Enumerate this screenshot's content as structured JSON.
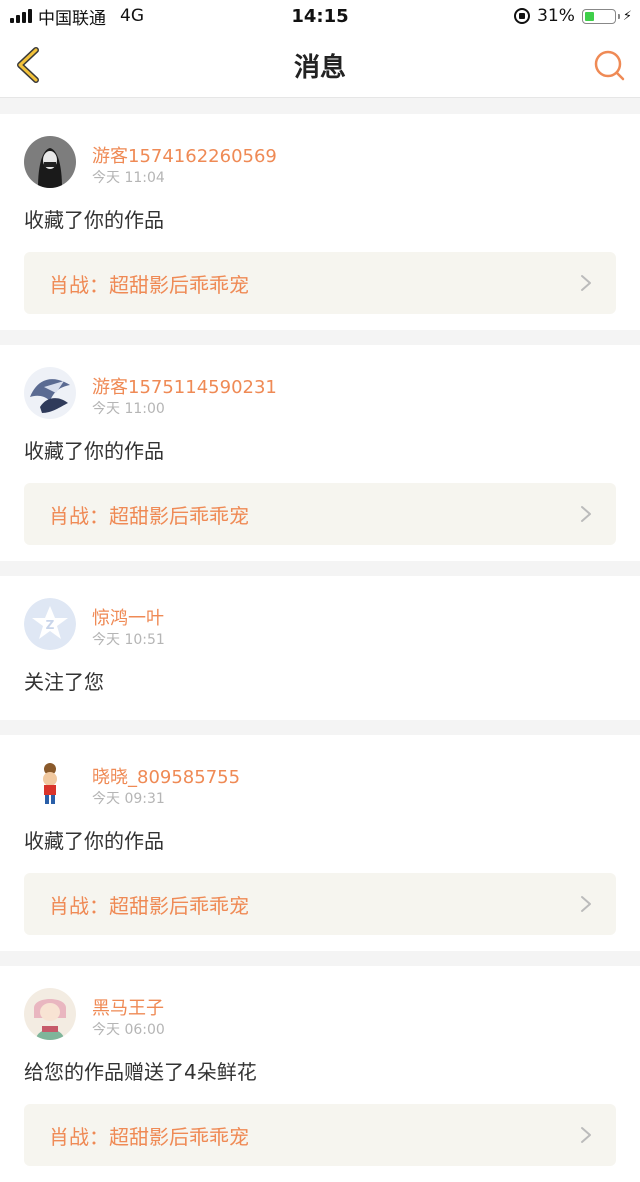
{
  "status_bar": {
    "carrier": "中国联通",
    "network": "4G",
    "time": "14:15",
    "battery_percent": "31%",
    "battery_level": 0.31
  },
  "nav": {
    "title": "消息",
    "back_icon": "chevron-left-icon",
    "search_icon": "search-icon",
    "accent_color": "#ef8a55"
  },
  "colors": {
    "username": "#ef8a55",
    "timestamp": "#b5b5b5",
    "work_bg": "#f6f5ef",
    "page_bg": "#f4f4f4"
  },
  "messages": [
    {
      "username": "游客1574162260569",
      "time": "今天 11:04",
      "action": "收藏了你的作品",
      "work": "肖战：超甜影后乖乖宠"
    },
    {
      "username": "游客1575114590231",
      "time": "今天 11:00",
      "action": "收藏了你的作品",
      "work": "肖战：超甜影后乖乖宠"
    },
    {
      "username": "惊鸿一叶",
      "time": "今天 10:51",
      "action": "关注了您"
    },
    {
      "username": "晓晓_809585755",
      "time": "今天 09:31",
      "action": "收藏了你的作品",
      "work": "肖战：超甜影后乖乖宠"
    },
    {
      "username": "黑马王子",
      "time": "今天 06:00",
      "action": "给您的作品赠送了4朵鲜花",
      "work": "肖战：超甜影后乖乖宠"
    }
  ]
}
